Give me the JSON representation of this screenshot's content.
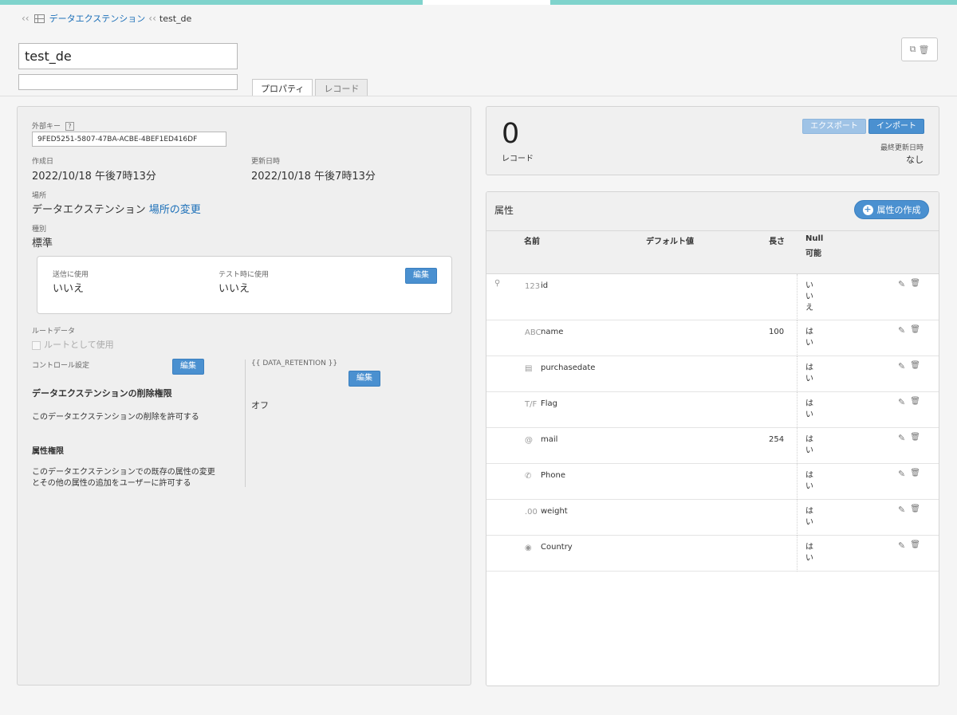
{
  "breadcrumb": {
    "parent": "データエクステンション",
    "current": "test_de"
  },
  "header": {
    "name_value": "test_de",
    "description_value": ""
  },
  "tabs": [
    {
      "label": "プロパティ",
      "active": true
    },
    {
      "label": "レコード",
      "active": false
    }
  ],
  "toolbar": {
    "copy_icon": "copy-icon",
    "delete_icon": "trash-icon"
  },
  "properties": {
    "external_key_label": "外部キー",
    "external_key_help": "?",
    "external_key_value": "9FED5251-5807-47BA-ACBE-4BEF1ED416DF",
    "created_label": "作成日",
    "created_value": "2022/10/18 午後7時13分",
    "modified_label": "更新日時",
    "modified_value": "2022/10/18 午後7時13分",
    "location_label": "場所",
    "location_value": "データエクステンション",
    "location_change": "場所の変更",
    "type_label": "種別",
    "type_value": "標準",
    "sendable_label": "送信に使用",
    "sendable_value": "いいえ",
    "testable_label": "テスト時に使用",
    "testable_value": "いいえ",
    "edit_label": "編集",
    "root_label": "ルートデータ",
    "root_checkbox": "ルートとして使用",
    "control_label": "コントロール設定",
    "delete_perm_title": "データエクステンションの削除権限",
    "delete_perm_text": "このデータエクステンションの削除を許可する",
    "attr_perm_title": "属性権限",
    "attr_perm_text_1": "このデータエクステンションでの既存の属性の変更",
    "attr_perm_text_2": "とその他の属性の追加をユーザーに許可する",
    "retention_label": "{{ DATA_RETENTION }}",
    "retention_value": "オフ"
  },
  "records": {
    "count": "0",
    "count_label": "レコード",
    "export_label": "エクスポート",
    "import_label": "インポート",
    "last_updated_label": "最終更新日時",
    "last_updated_value": "なし"
  },
  "attributes": {
    "title": "属性",
    "create_label": "属性の作成",
    "columns": {
      "name": "名前",
      "default": "デフォルト値",
      "length": "長さ",
      "null_1": "Null",
      "null_2": "可能"
    },
    "rows": [
      {
        "icon": "123",
        "icon_name": "number-icon",
        "name": "id",
        "length": "",
        "nullable": "いいえ",
        "primary_key": true
      },
      {
        "icon": "ABC",
        "icon_name": "text-icon",
        "name": "name",
        "length": "100",
        "nullable": "はい",
        "primary_key": false
      },
      {
        "icon": "▤",
        "icon_name": "calendar-icon",
        "name": "purchasedate",
        "length": "",
        "nullable": "はい",
        "primary_key": false
      },
      {
        "icon": "T/F",
        "icon_name": "boolean-icon",
        "name": "Flag",
        "length": "",
        "nullable": "はい",
        "primary_key": false
      },
      {
        "icon": "@",
        "icon_name": "email-icon",
        "name": "mail",
        "length": "254",
        "nullable": "はい",
        "primary_key": false
      },
      {
        "icon": "✆",
        "icon_name": "phone-icon",
        "name": "Phone",
        "length": "",
        "nullable": "はい",
        "primary_key": false
      },
      {
        "icon": ".00",
        "icon_name": "decimal-icon",
        "name": "weight",
        "length": "",
        "nullable": "はい",
        "primary_key": false
      },
      {
        "icon": "◉",
        "icon_name": "location-pin-icon",
        "name": "Country",
        "length": "",
        "nullable": "はい",
        "primary_key": false
      }
    ]
  }
}
